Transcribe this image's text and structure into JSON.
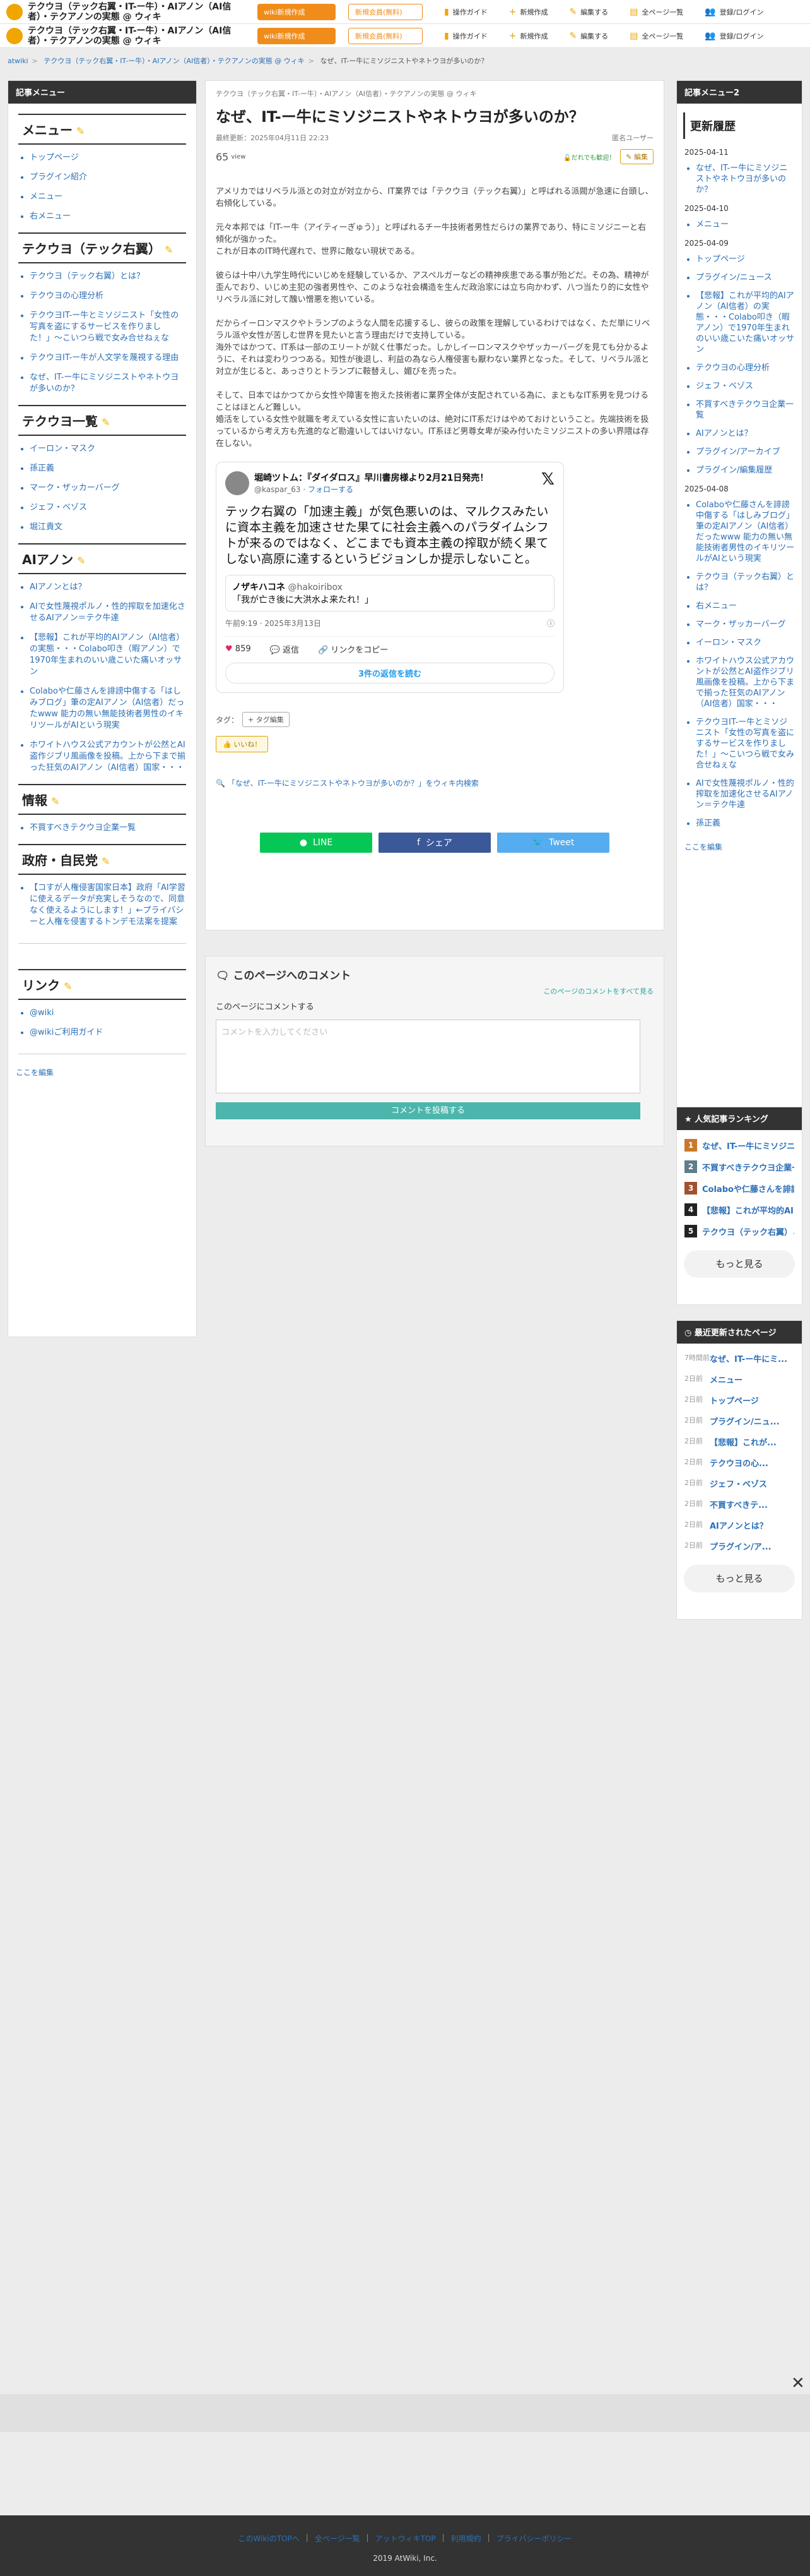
{
  "header": {
    "site_title": "テクウヨ（テック右翼・IT-ー牛）・AIアノン（AI信者）・テクアノンの実態 @ ウィキ",
    "btn_create": "wiki新規作成",
    "btn_member": "新規会員(無料)",
    "nav": [
      "操作ガイド",
      "新規作成",
      "編集する",
      "全ページ一覧",
      "登録/ログイン"
    ]
  },
  "breadcrumb": {
    "home": "atwiki",
    "site": "テクウヨ（テック右翼・IT-ー牛）・AIアノン（AI信者）・テクアノンの実態 @ ウィキ",
    "current": "なぜ、IT-ー牛にミソジニストやネトウヨが多いのか？"
  },
  "left": {
    "head": "記事メニュー",
    "sections": [
      {
        "title": "メニュー",
        "items": [
          "トップページ",
          "プラグイン紹介",
          "メニュー",
          "右メニュー"
        ]
      },
      {
        "title": "テクウヨ（テック右翼）",
        "items": [
          "テクウヨ（テック右翼）とは？",
          "テクウヨの心理分析",
          "テクウヨIT-ー牛とミソジニスト「女性の写真を盗にするサービスを作りました！」〜こいつら戦で女み合せねぇな",
          "テクウヨIT-ー牛が人文学を蔑視する理由",
          "なぜ、IT-ー牛にミソジニストやネトウヨが多いのか？"
        ]
      },
      {
        "title": "テクウヨ一覧",
        "items": [
          "イーロン・マスク",
          "孫正義",
          "マーク・ザッカーバーグ",
          "ジェフ・ベゾス",
          "堀江貴文"
        ]
      },
      {
        "title": "AIアノン",
        "items": [
          "AIアノンとは？",
          "AIで女性蔑視ポルノ・性的搾取を加速化させるAIアノン＝テク牛達",
          "【悲報】これが平均的AIアノン（AI信者）の実態・・・Colabo叩き（暇アノン）で1970年生まれのいい歳こいた痛いオッサン",
          "Colaboや仁藤さんを誹謗中傷する「はしみブログ」筆の定AIアノン（AI信者）だったwww 能力の無い無能技術者男性のイキリツールがAIという現実",
          "ホワイトハウス公式アカウントが公然とAI盗作ジブリ風画像を投稿。上から下まで揃った狂気のAIアノン（AI信者）国家・・・"
        ]
      },
      {
        "title": "情報",
        "items": [
          "不買すべきテクウヨ企業一覧"
        ]
      },
      {
        "title": "政府・自民党",
        "items": [
          "【コすが人権侵害国家日本】政府「AI学習に使えるデータが充実しそうなので、同意なく使えるようにします！」←プライバシーと人権を侵害するトンデモ法案を提案"
        ]
      },
      {
        "title": "リンク",
        "items": [
          "@wiki",
          "@wikiご利用ガイド"
        ]
      }
    ],
    "edit": "ここを編集"
  },
  "main": {
    "category": "テクウヨ（テック右翼・IT-ー牛）・AIアノン（AI信者）・テクアノンの実態 @ ウィキ",
    "title": "なぜ、IT-ー牛にミソジニストやネトウヨが多いのか？",
    "updated": "最終更新：2025年04月11日 22:23",
    "author": "匿名ユーザー",
    "views": "65",
    "views_unit": "view",
    "lock": "だれでも歓迎！",
    "edit": "編集",
    "paragraphs": [
      "アメリカではリベラル派との対立が対立から、IT業界では「テクウヨ（テック右翼）」と呼ばれる派閥が急速に台頭し、右傾化している。",
      "元々本邦では「IT-ー牛（アイティーぎゅう）」と呼ばれるチー牛技術者男性だらけの業界であり、特にミソジニーと右傾化が強かった。\nこれが日本のIT時代遅れで、世界に敵ない現状である。",
      "彼らは十中八九学生時代にいじめを経験しているか、アスペルガーなどの精神疾患である事が殆どだ。その為、精神が歪んでおり、いじめ主犯の強者男性や、このような社会構造を生んだ政治家には立ち向かわず、八つ当たり的に女性やリベラル派に対して醜い憎悪を抱いている。",
      "だからイーロンマスクやトランプのような人間を応援するし、彼らの政策を理解しているわけではなく、ただ単にリベラル派や女性が苦しむ世界を見たいと言う理由だけで支持している。\n海外ではかつて、IT系は一部のエリートが就く仕事だった。しかしイーロンマスクやザッカーバーグを見ても分かるように、それは変わりつつある。知性が後退し、利益の為なら人権侵害も厭わない業界となった。そして、リベラル派と対立が生じると、あっさりとトランプに鞍替えし、媚びを売った。",
      "そして、日本ではかつてから女性や障害を抱えた技術者に業界全体が支配されている為に、まともなIT系男を見つけることはほとんど難しい。\n婚活をしている女性や就職を考えている女性に言いたいのは、絶対にIT系だけはやめておけということ。先端技術を扱っているから考え方も先進的など勘違いしてはいけない。IT系ほど男尊女卑が染み付いたミソジニストの多い界隈は存在しない。"
    ],
    "tweet": {
      "name": "堀崎ツトム：『ダイダロス』早川書房様より2月21日発売！",
      "handle": "@kaspar_63",
      "follow": "フォローする",
      "text": "テック右翼の「加速主義」が気色悪いのは、マルクスみたいに資本主義を加速させた果てに社会主義へのパラダイムシフトが来るのではなく、どこまでも資本主義の搾取が続く果てしない高原に達するというビジョンしか提示しないこと。",
      "quote_name": "ノザキハコネ",
      "quote_handle": "@hakoiribox",
      "quote_text": "「我が亡き後に大洪水よ来たれ！」",
      "time": "午前9:19 · 2025年3月13日",
      "likes": "859",
      "reply": "返信",
      "copy": "リンクをコピー",
      "more": "3件の返信を読む"
    },
    "tag_label": "タグ：",
    "tag_btn": "+ タグ編集",
    "good": "いいね！",
    "backlink": "「なぜ、IT-ー牛にミソジニストやネトウヨが多いのか？」をウィキ内検索",
    "share": [
      "LINE",
      "シェア",
      "Tweet"
    ]
  },
  "comment": {
    "title": "このページへのコメント",
    "all": "このページのコメントをすべて見る",
    "label": "このページにコメントする",
    "placeholder": "コメントを入力してください",
    "submit": "コメントを投稿する"
  },
  "right": {
    "head": "記事メニュー2",
    "history_title": "更新履歴",
    "groups": [
      {
        "date": "2025-04-11",
        "items": [
          "なぜ、IT-ー牛にミソジニストやネトウヨが多いのか？"
        ]
      },
      {
        "date": "2025-04-10",
        "items": [
          "メニュー"
        ]
      },
      {
        "date": "2025-04-09",
        "items": [
          "トップページ",
          "プラグイン/ニュース",
          "【悲報】これが平均的AIアノン（AI信者）の実態・・・Colabo叩き（暇アノン）で1970年生まれのいい歳こいた痛いオッサン",
          "テクウヨの心理分析",
          "ジェフ・ベゾス",
          "不買すべきテクウヨ企業一覧",
          "AIアノンとは？",
          "プラグイン/アーカイブ",
          "プラグイン/編集履歴"
        ]
      },
      {
        "date": "2025-04-08",
        "items": [
          "Colaboや仁藤さんを誹謗中傷する「はしみブログ」筆の定AIアノン（AI信者）だったwww 能力の無い無能技術者男性のイキリツールがAIという現実",
          "テクウヨ（テック右翼）とは？",
          "右メニュー",
          "マーク・ザッカーバーグ",
          "イーロン・マスク",
          "ホワイトハウス公式アカウントが公然とAI盗作ジブリ風画像を投稿。上から下まで揃った狂気のAIアノン（AI信者）国家・・・",
          "テクウヨIT-ー牛とミソジニスト「女性の写真を盗にするサービスを作りました！」〜こいつら戦で女み合せねぇな",
          "AIで女性蔑視ポルノ・性的搾取を加速化させるAIアノン＝テク牛達",
          "孫正義"
        ]
      }
    ],
    "edit": "ここを編集",
    "ranking_title": "人気記事ランキング",
    "ranking": [
      "なぜ、IT-ー牛にミソジニスト...",
      "不買すべきテクウヨ企業一覧",
      "Colaboや仁藤さんを誹謗中...",
      "【悲報】これが平均的AIアノン...",
      "テクウヨ（テック右翼）とは？"
    ],
    "rank_colors": [
      "#c87a2a",
      "#607d8b",
      "#a0522d",
      "#222",
      "#222"
    ],
    "more": "もっと見る",
    "recent_title": "最近更新されたページ",
    "recent": [
      {
        "d": "7時間前",
        "t": "なぜ、IT-ー牛にミ..."
      },
      {
        "d": "2日前",
        "t": "メニュー"
      },
      {
        "d": "2日前",
        "t": "トップページ"
      },
      {
        "d": "2日前",
        "t": "プラグイン/ニュ..."
      },
      {
        "d": "2日前",
        "t": "【悲報】これが..."
      },
      {
        "d": "2日前",
        "t": "テクウヨの心..."
      },
      {
        "d": "2日前",
        "t": "ジェフ・ベゾス"
      },
      {
        "d": "2日前",
        "t": "不買すべきテ..."
      },
      {
        "d": "2日前",
        "t": "AIアノンとは？"
      },
      {
        "d": "2日前",
        "t": "プラグイン/ア..."
      }
    ]
  },
  "footer": {
    "links": [
      "このWikiのTOPへ",
      "全ページ一覧",
      "アットウィキTOP",
      "利用規約",
      "プライバシーポリシー"
    ],
    "copyright": "2019 AtWiki, Inc."
  }
}
